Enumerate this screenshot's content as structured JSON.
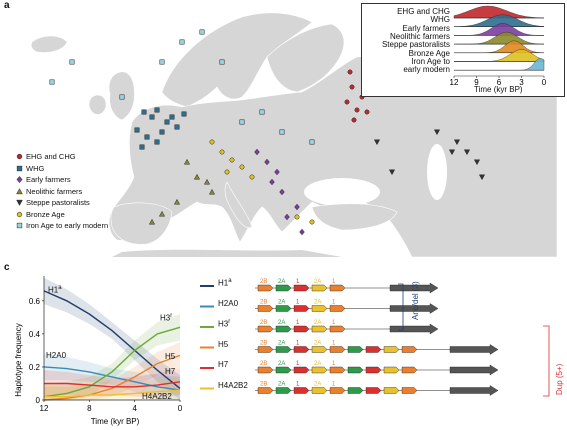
{
  "panel_a": {
    "letter": "a",
    "legend": [
      {
        "label": "EHG and CHG",
        "color": "#c0282d",
        "shape": "circle"
      },
      {
        "label": "WHG",
        "color": "#2f6e8f",
        "shape": "square"
      },
      {
        "label": "Early farmers",
        "color": "#7b3fa0",
        "shape": "diamond"
      },
      {
        "label": "Neolithic farmers",
        "color": "#8a8a2a",
        "shape": "triangle-up"
      },
      {
        "label": "Steppe pastoralists",
        "color": "#333333",
        "shape": "triangle-down"
      },
      {
        "label": "Bronze Age",
        "color": "#e0c020",
        "shape": "circle"
      },
      {
        "label": "Iron Age to early modern",
        "color": "#9ad3e0",
        "shape": "square"
      }
    ],
    "inset": {
      "rows": [
        "EHG and CHG",
        "WHG",
        "Early farmers",
        "Neolithic farmers",
        "Steppe pastoralists",
        "Bronze Age",
        "Iron Age to early modern"
      ],
      "row_labels_display": [
        "EHG and CHG",
        "WHG",
        "Early farmers",
        "Neolithic farmers",
        "Steppe pastoralists",
        "Bronze Age",
        "Iron Age to",
        "early modern"
      ],
      "colors": [
        "#c0282d",
        "#2f6e8f",
        "#7b3fa0",
        "#8a8a2a",
        "#e08a20",
        "#e0c020",
        "#6ab6d6"
      ],
      "x_ticks": [
        "12",
        "9",
        "6",
        "3",
        "0"
      ],
      "xlabel": "Time (kyr BP)"
    }
  },
  "panel_c": {
    "letter": "c",
    "chart_data": {
      "type": "line",
      "ylabel": "Haplotype frequency",
      "xlabel": "Time (kyr BP)",
      "x_ticks": [
        "12",
        "8",
        "4",
        "0"
      ],
      "y_ticks": [
        "0",
        "0.2",
        "0.4",
        "0.6"
      ],
      "xlim": [
        12,
        0
      ],
      "ylim": [
        0,
        0.75
      ],
      "x": [
        12,
        10,
        8,
        6,
        4,
        2,
        0
      ],
      "series": [
        {
          "name": "H1a",
          "color": "#1f3f6e",
          "values": [
            0.66,
            0.6,
            0.52,
            0.42,
            0.3,
            0.18,
            0.07
          ]
        },
        {
          "name": "H2A0",
          "color": "#3a8ab8",
          "values": [
            0.2,
            0.19,
            0.17,
            0.14,
            0.11,
            0.08,
            0.06
          ]
        },
        {
          "name": "H3r",
          "color": "#6aaa3a",
          "values": [
            0.02,
            0.04,
            0.08,
            0.17,
            0.3,
            0.4,
            0.44
          ]
        },
        {
          "name": "H5",
          "color": "#e88030",
          "values": [
            0.0,
            0.01,
            0.03,
            0.07,
            0.14,
            0.22,
            0.27
          ]
        },
        {
          "name": "H7",
          "color": "#d93030",
          "values": [
            0.1,
            0.1,
            0.09,
            0.08,
            0.08,
            0.09,
            0.11
          ]
        },
        {
          "name": "H4A2B2",
          "color": "#e8c030",
          "values": [
            0.02,
            0.02,
            0.03,
            0.03,
            0.04,
            0.05,
            0.06
          ]
        }
      ],
      "labels": [
        {
          "text": "H1a",
          "main": "H1",
          "sup": "a"
        },
        {
          "text": "H3r",
          "main": "H3",
          "sup": "r"
        },
        {
          "text": "H2A0",
          "main": "H2A0",
          "sup": ""
        },
        {
          "text": "H5",
          "main": "H5",
          "sup": ""
        },
        {
          "text": "H7",
          "main": "H7",
          "sup": ""
        },
        {
          "text": "H4A2B2",
          "main": "H4A2B2",
          "sup": ""
        }
      ]
    },
    "haplotypes": [
      {
        "name": "H1",
        "sup": "a",
        "color": "#1f3f6e"
      },
      {
        "name": "H2A0",
        "sup": "",
        "color": "#3a8ab8"
      },
      {
        "name": "H3",
        "sup": "r",
        "color": "#6aaa3a"
      },
      {
        "name": "H5",
        "sup": "",
        "color": "#e88030"
      },
      {
        "name": "H7",
        "sup": "",
        "color": "#d93030"
      },
      {
        "name": "H4A2B2",
        "sup": "",
        "color": "#e8c030"
      }
    ],
    "segment_labels": {
      "a": "2B",
      "b": "2A",
      "c": "1",
      "d": "2A",
      "e": "1"
    },
    "groups": [
      {
        "label": "Anc/del (3)",
        "color": "#1f3f6e"
      },
      {
        "label": "Dup (5+)",
        "color": "#d93030"
      }
    ]
  }
}
